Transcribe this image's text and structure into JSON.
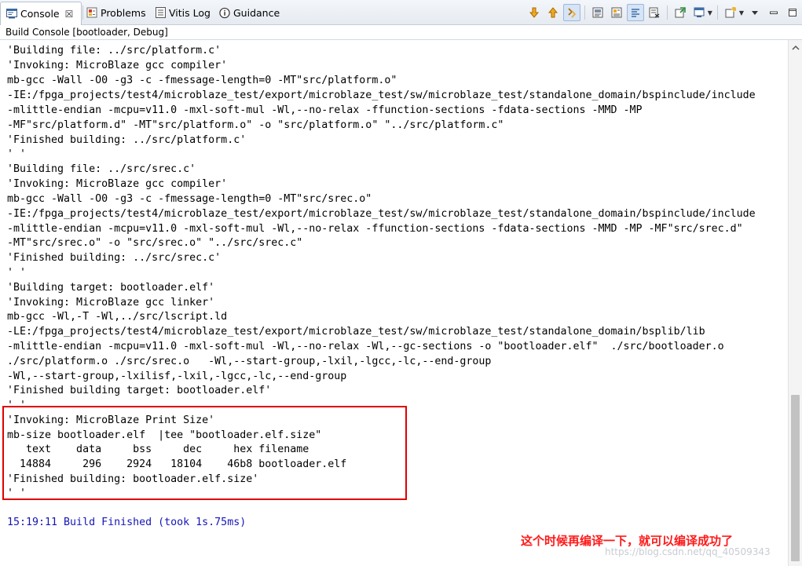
{
  "tabs": [
    {
      "label": "Console",
      "icon": "console-icon",
      "active": true,
      "close": "☒"
    },
    {
      "label": "Problems",
      "icon": "problems-icon"
    },
    {
      "label": "Vitis Log",
      "icon": "log-icon"
    },
    {
      "label": "Guidance",
      "icon": "info-icon"
    }
  ],
  "toolbar_icons": [
    "scroll-down-icon",
    "scroll-up-icon",
    "scroll-lock-icon",
    "word-wrap-icon",
    "pin-console-icon",
    "show-console-icon",
    "clear-console-icon",
    "terminate-icon",
    "display-selected-console-icon",
    "open-console-icon",
    "view-menu-icon",
    "minimize-icon",
    "maximize-icon"
  ],
  "console_title": "Build Console [bootloader, Debug]",
  "output_lines": [
    "'Building file: ../src/platform.c'",
    "'Invoking: MicroBlaze gcc compiler'",
    "mb-gcc -Wall -O0 -g3 -c -fmessage-length=0 -MT\"src/platform.o\"",
    "-IE:/fpga_projects/test4/microblaze_test/export/microblaze_test/sw/microblaze_test/standalone_domain/bspinclude/include",
    "-mlittle-endian -mcpu=v11.0 -mxl-soft-mul -Wl,--no-relax -ffunction-sections -fdata-sections -MMD -MP",
    "-MF\"src/platform.d\" -MT\"src/platform.o\" -o \"src/platform.o\" \"../src/platform.c\"",
    "'Finished building: ../src/platform.c'",
    "' '",
    "'Building file: ../src/srec.c'",
    "'Invoking: MicroBlaze gcc compiler'",
    "mb-gcc -Wall -O0 -g3 -c -fmessage-length=0 -MT\"src/srec.o\"",
    "-IE:/fpga_projects/test4/microblaze_test/export/microblaze_test/sw/microblaze_test/standalone_domain/bspinclude/include",
    "-mlittle-endian -mcpu=v11.0 -mxl-soft-mul -Wl,--no-relax -ffunction-sections -fdata-sections -MMD -MP -MF\"src/srec.d\"",
    "-MT\"src/srec.o\" -o \"src/srec.o\" \"../src/srec.c\"",
    "'Finished building: ../src/srec.c'",
    "' '",
    "'Building target: bootloader.elf'",
    "'Invoking: MicroBlaze gcc linker'",
    "mb-gcc -Wl,-T -Wl,../src/lscript.ld",
    "-LE:/fpga_projects/test4/microblaze_test/export/microblaze_test/sw/microblaze_test/standalone_domain/bsplib/lib",
    "-mlittle-endian -mcpu=v11.0 -mxl-soft-mul -Wl,--no-relax -Wl,--gc-sections -o \"bootloader.elf\"  ./src/bootloader.o",
    "./src/platform.o ./src/srec.o   -Wl,--start-group,-lxil,-lgcc,-lc,--end-group",
    "-Wl,--start-group,-lxilisf,-lxil,-lgcc,-lc,--end-group",
    "'Finished building target: bootloader.elf'",
    "' '",
    "'Invoking: MicroBlaze Print Size'",
    "mb-size bootloader.elf  |tee \"bootloader.elf.size\"",
    "   text    data     bss     dec     hex filename",
    "  14884     296    2924   18104    46b8 bootloader.elf",
    "'Finished building: bootloader.elf.size'",
    "' '",
    "",
    "15:19:11 Build Finished (took 1s.75ms)"
  ],
  "annotation_note": "这个时候再编译一下，就可以编译成功了",
  "watermark": "https://blog.csdn.net/qq_40509343",
  "colors": {
    "highlight_border": "#e00000",
    "note_text": "#ff1a1a",
    "build_finished_text": "#1515b8"
  }
}
